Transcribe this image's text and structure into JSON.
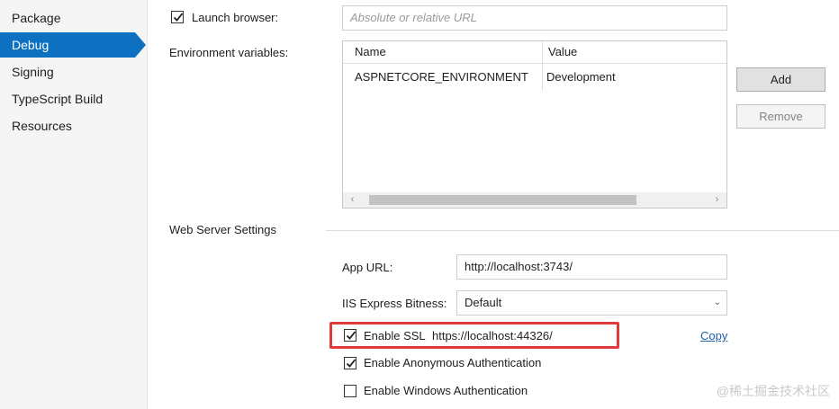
{
  "sidebar": {
    "items": [
      {
        "label": "Package"
      },
      {
        "label": "Debug"
      },
      {
        "label": "Signing"
      },
      {
        "label": "TypeScript Build"
      },
      {
        "label": "Resources"
      }
    ],
    "active_index": 1
  },
  "launch": {
    "checkbox_label": "Launch browser:",
    "checked": true,
    "url_placeholder": "Absolute or relative URL"
  },
  "env": {
    "label": "Environment variables:",
    "columns": [
      "Name",
      "Value"
    ],
    "rows": [
      {
        "name": "ASPNETCORE_ENVIRONMENT",
        "value": "Development"
      }
    ],
    "add_label": "Add",
    "remove_label": "Remove"
  },
  "web_server": {
    "section_title": "Web Server Settings",
    "app_url_label": "App URL:",
    "app_url_value": "http://localhost:3743/",
    "bitness_label": "IIS Express Bitness:",
    "bitness_value": "Default",
    "ssl_label": "Enable SSL",
    "ssl_url": "https://localhost:44326/",
    "ssl_checked": true,
    "copy_label": "Copy",
    "anon_label": "Enable Anonymous Authentication",
    "anon_checked": true,
    "windows_label": "Enable Windows Authentication",
    "windows_checked": false
  },
  "colors": {
    "accent": "#0e70c0",
    "highlight": "#e03b3b"
  },
  "watermark": "@稀土掘金技术社区"
}
